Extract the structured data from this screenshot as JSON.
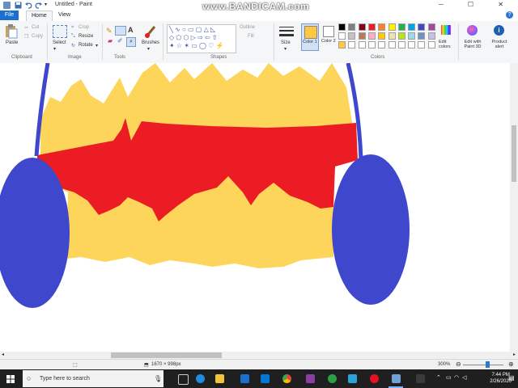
{
  "titlebar": {
    "title": "Untitled - Paint",
    "watermark": "www.BANDICAM.com",
    "controls": "─ ☐ ✕"
  },
  "menu": {
    "tabs": [
      "File",
      "Home",
      "View"
    ]
  },
  "ribbon": {
    "clipboard": {
      "paste": "Paste",
      "cut": "Cut",
      "copy": "Copy",
      "label": "Clipboard"
    },
    "image": {
      "select": "Select",
      "crop": "Crop",
      "resize": "Resize",
      "rotate": "Rotate",
      "label": "Image"
    },
    "tools": {
      "brushes": "Brushes",
      "label": "Tools",
      "text_tool": "A"
    },
    "shapes": {
      "outline": "Outline",
      "fill": "Fill",
      "label": "Shapes"
    },
    "size": {
      "label": "Size"
    },
    "colors": {
      "color1": "Color 1",
      "color2": "Color 2",
      "edit_colors": "Edit colors",
      "label": "Colors",
      "color1_value": "#ffc83d",
      "palette": [
        "#000000",
        "#7f7f7f",
        "#880015",
        "#ed1c24",
        "#ff7f27",
        "#fff200",
        "#22b14c",
        "#00a2e8",
        "#3f48cc",
        "#a349a4",
        "#ffffff",
        "#c3c3c3",
        "#b97a57",
        "#ffaec9",
        "#ffc90e",
        "#efe4b0",
        "#b5e61d",
        "#99d9ea",
        "#7092be",
        "#c8bfe7",
        "#ffc83d",
        "#ffffff",
        "#ffffff",
        "#ffffff",
        "#ffffff",
        "#ffffff",
        "#ffffff",
        "#ffffff",
        "#ffffff",
        "#ffffff"
      ]
    },
    "paint3d": "Edit with Paint 3D",
    "product_alert": "Product alert"
  },
  "canvas_colors": {
    "yellow": "#fdd55a",
    "red": "#ec1c24",
    "blue": "#3f48cc"
  },
  "status": {
    "dimensions": "1670 × 998px",
    "zoom": "300%",
    "zoom_fraction": 0.6
  },
  "taskbar": {
    "search_placeholder": "Type here to search",
    "time": "7:44 PM",
    "date": "2/26/2020"
  }
}
